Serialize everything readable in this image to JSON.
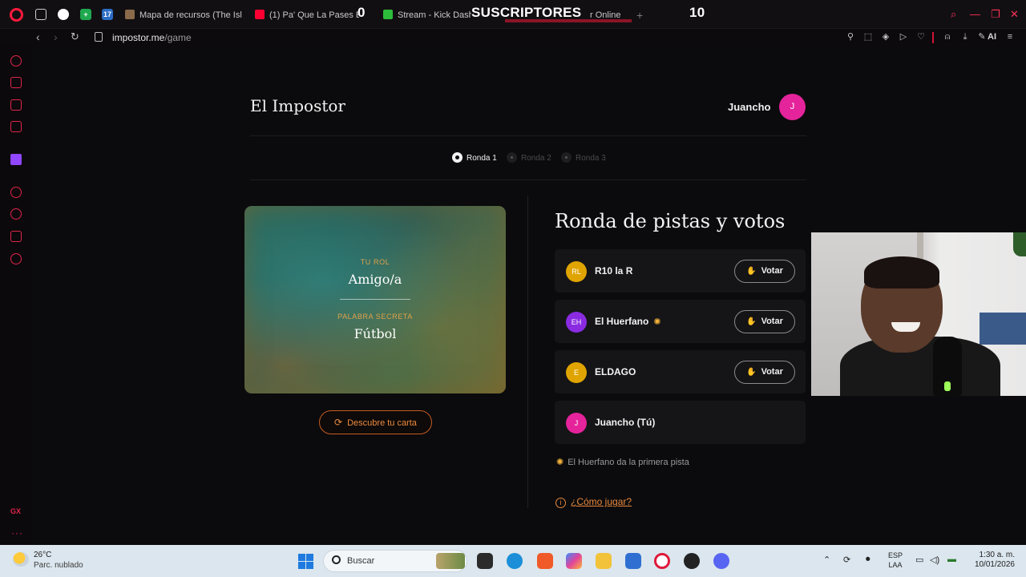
{
  "browser": {
    "tabs": [
      {
        "label": "Mapa de recursos (The Isla"
      },
      {
        "label": "(1) Pa' Que La Pases Bie"
      },
      {
        "label": "Stream - Kick Dashb"
      },
      {
        "label": "r Online"
      }
    ],
    "new_tab_label": "+",
    "overlay": {
      "left_count": "0",
      "title": "SUSCRIPTORES",
      "right_count": "10"
    },
    "url_host": "impostor.me",
    "url_path": "/game",
    "ai_label": "AI"
  },
  "sidebar": {
    "gx_label": "GX",
    "more_label": "···"
  },
  "header": {
    "brand": "El Impostor",
    "username": "Juancho",
    "avatar_initial": "J"
  },
  "rounds": [
    {
      "label": "Ronda 1",
      "active": true
    },
    {
      "label": "Ronda 2",
      "active": false
    },
    {
      "label": "Ronda 3",
      "active": false
    }
  ],
  "card": {
    "role_label": "TU ROL",
    "role_value": "Amigo/a",
    "secret_label": "PALABRA SECRETA",
    "secret_value": "Fútbol"
  },
  "reveal_button": {
    "label": "Descubre tu carta"
  },
  "section_title": "Ronda de pistas y votos",
  "players": [
    {
      "initials": "RL",
      "name": "R10 la R",
      "color": "#e0a400",
      "first_clue": false,
      "vote_label": "Votar"
    },
    {
      "initials": "EH",
      "name": "El Huerfano",
      "color": "#8a2be2",
      "first_clue": true,
      "vote_label": "Votar"
    },
    {
      "initials": "E",
      "name": "ELDAGO",
      "color": "#e0a400",
      "first_clue": false,
      "vote_label": "Votar"
    },
    {
      "initials": "J",
      "name": "Juancho (Tú)",
      "color": "#e5239b",
      "first_clue": false,
      "vote_label": ""
    }
  ],
  "hint_text": "El Huerfano da la primera pista",
  "howto_label": "¿Cómo jugar?",
  "taskbar": {
    "temperature": "26°C",
    "weather_desc": "Parc. nublado",
    "search_placeholder": "Buscar",
    "lang_top": "ESP",
    "lang_bottom": "LAA",
    "time": "1:30 a. m.",
    "date": "10/01/2026"
  }
}
